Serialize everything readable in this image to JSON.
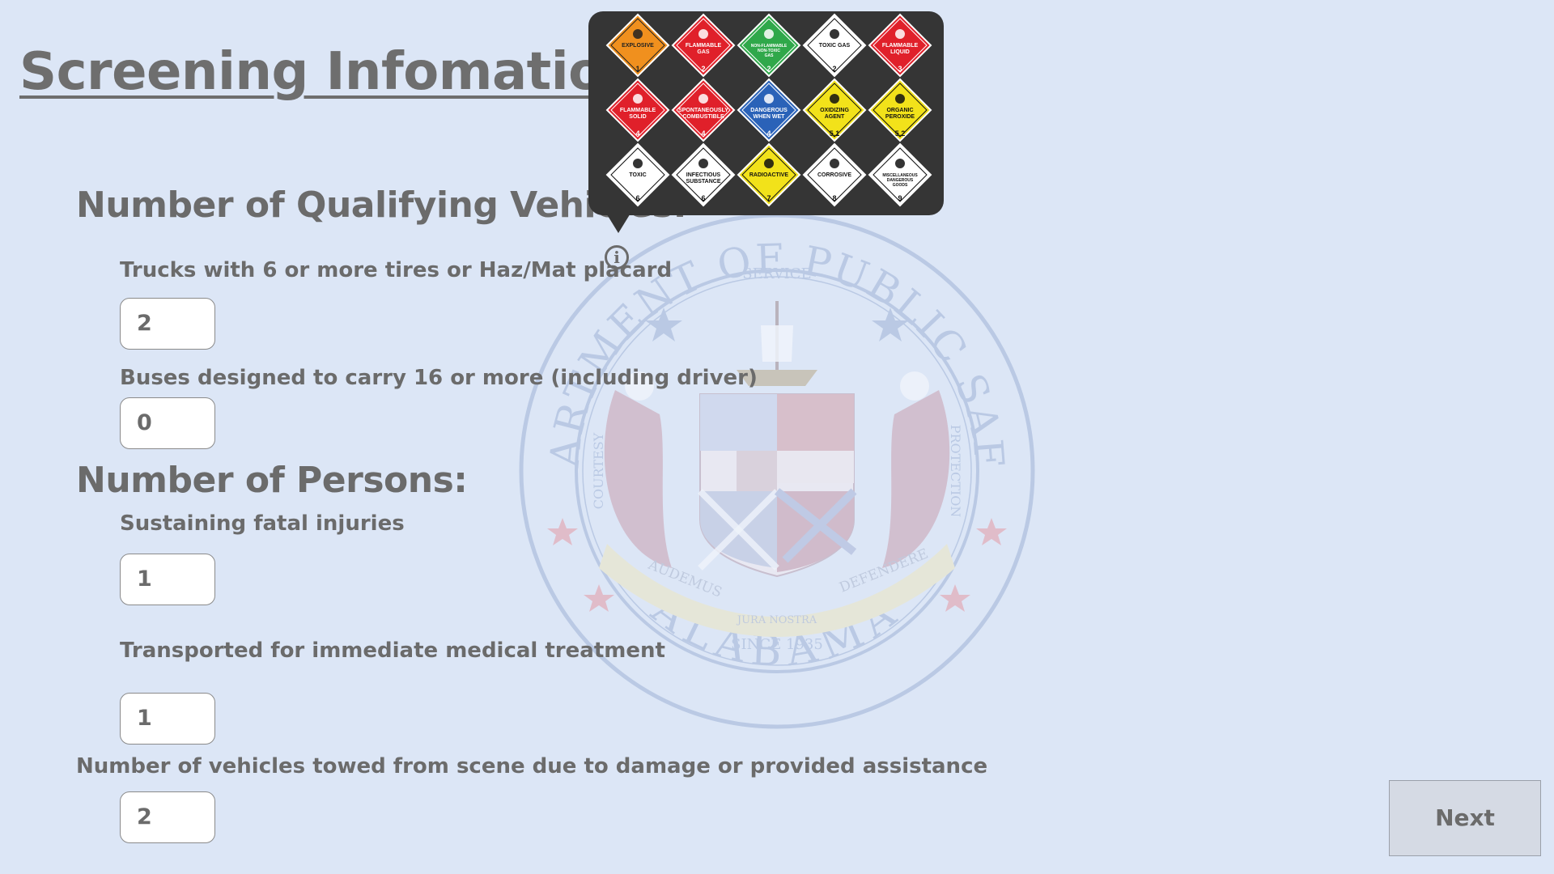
{
  "page": {
    "title": "Screening Infomation"
  },
  "vehicles": {
    "heading": "Number of Qualifying Vehicles:",
    "trucks_label": "Trucks with 6 or more tires or Haz/Mat placard",
    "trucks_value": "2",
    "buses_label": "Buses designed to carry 16 or more (including driver)",
    "buses_value": "0"
  },
  "persons": {
    "heading": "Number of Persons:",
    "fatal_label": "Sustaining fatal injuries",
    "fatal_value": "1",
    "transported_label": "Transported for immediate medical treatment",
    "transported_value": "1"
  },
  "towed": {
    "label": "Number of vehicles towed from scene due to damage or provided assistance",
    "value": "2"
  },
  "actions": {
    "next_label": "Next"
  },
  "info_icon": {
    "glyph": "i"
  },
  "hazmat_popup": {
    "placards": [
      {
        "text": "EXPLOSIVE",
        "num": "1",
        "color": "#f0901e",
        "fg": "#222"
      },
      {
        "text": "FLAMMABLE GAS",
        "num": "2",
        "color": "#e0202a",
        "fg": "#fff"
      },
      {
        "text": "NON-FLAMMABLE NON-TOXIC GAS",
        "num": "2",
        "color": "#2fa84a",
        "fg": "#fff"
      },
      {
        "text": "TOXIC GAS",
        "num": "2",
        "color": "#ffffff",
        "fg": "#111"
      },
      {
        "text": "FLAMMABLE LIQUID",
        "num": "3",
        "color": "#e0202a",
        "fg": "#fff"
      },
      {
        "text": "FLAMMABLE SOLID",
        "num": "4",
        "color": "#e0202a",
        "fg": "#fff"
      },
      {
        "text": "SPONTANEOUSLY COMBUSTIBLE",
        "num": "4",
        "color": "#e0202a",
        "fg": "#fff"
      },
      {
        "text": "DANGEROUS WHEN WET",
        "num": "4",
        "color": "#2a62b8",
        "fg": "#fff"
      },
      {
        "text": "OXIDIZING AGENT",
        "num": "5.1",
        "color": "#f2e21a",
        "fg": "#111"
      },
      {
        "text": "ORGANIC PEROXIDE",
        "num": "5.2",
        "color": "#f2e21a",
        "fg": "#111"
      },
      {
        "text": "TOXIC",
        "num": "6",
        "color": "#ffffff",
        "fg": "#111"
      },
      {
        "text": "INFECTIOUS SUBSTANCE",
        "num": "6",
        "color": "#ffffff",
        "fg": "#111"
      },
      {
        "text": "RADIOACTIVE",
        "num": "7",
        "color": "#f2e21a",
        "fg": "#111"
      },
      {
        "text": "CORROSIVE",
        "num": "8",
        "color": "#ffffff",
        "fg": "#111"
      },
      {
        "text": "MISCELLANEOUS DANGEROUS GOODS",
        "num": "9",
        "color": "#ffffff",
        "fg": "#111"
      }
    ]
  },
  "seal": {
    "ring_top": "DEPARTMENT OF PUBLIC SAFETY",
    "ring_bottom": "ALABAMA",
    "service": "SERVICE",
    "courtesy": "COURTESY",
    "protection": "PROTECTION",
    "since": "SINCE 1935",
    "motto_left": "AUDEMUS",
    "motto_mid": "JURA NOSTRA",
    "motto_right": "DEFENDERE"
  }
}
